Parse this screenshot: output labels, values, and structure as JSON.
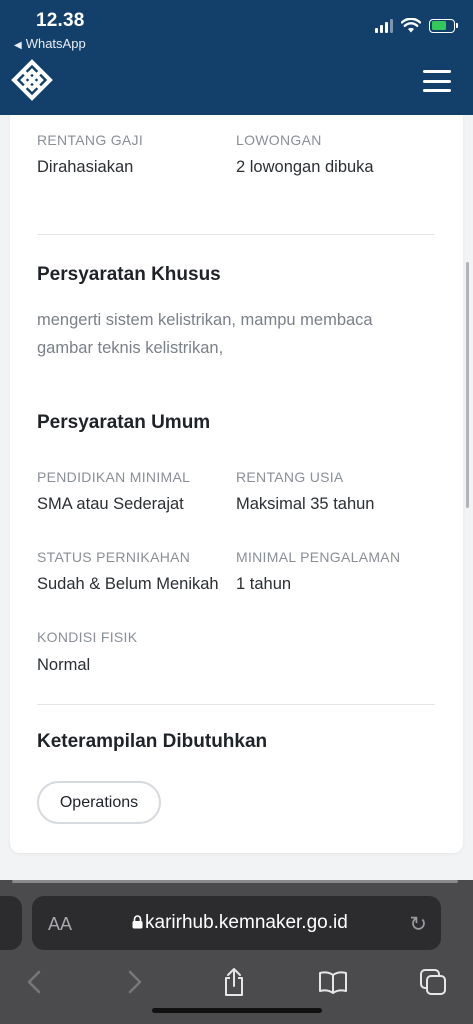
{
  "status_bar": {
    "time": "12.38",
    "back_app": "WhatsApp",
    "battery_color": "#34c759"
  },
  "header": {
    "brand_color": "#133f6b",
    "logo_icon": "kemnaker-logo-icon",
    "menu_icon": "hamburger-menu-icon"
  },
  "job": {
    "salary_label": "RENTANG GAJI",
    "salary_value": "Dirahasiakan",
    "vacancy_label": "LOWONGAN",
    "vacancy_value": "2 lowongan dibuka",
    "special_req_title": "Persyaratan Khusus",
    "special_req_text": "mengerti sistem kelistrikan, mampu membaca gambar teknis kelistrikan,",
    "general_req_title": "Persyaratan Umum",
    "education_label": "PENDIDIKAN MINIMAL",
    "education_value": "SMA atau Sederajat",
    "age_label": "RENTANG USIA",
    "age_value": "Maksimal 35 tahun",
    "marital_label": "STATUS PERNIKAHAN",
    "marital_value": "Sudah & Belum Menikah",
    "experience_label": "MINIMAL PENGALAMAN",
    "experience_value": "1 tahun",
    "physical_label": "KONDISI FISIK",
    "physical_value": "Normal",
    "skills_title": "Keterampilan Dibutuhkan",
    "skills": [
      "Operations"
    ]
  },
  "browser": {
    "text_size_label": "AA",
    "url": "karirhub.kemnaker.go.id",
    "toolbar_icons": [
      "back-icon",
      "forward-icon",
      "share-icon",
      "bookmarks-icon",
      "tabs-icon"
    ]
  }
}
